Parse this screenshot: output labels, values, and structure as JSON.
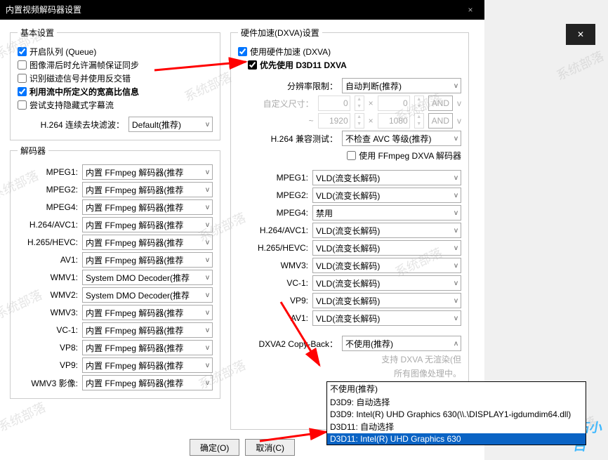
{
  "title": "内置视频解码器设置",
  "close_glyph": "×",
  "side_close_glyph": "✕",
  "basic": {
    "legend": "基本设置",
    "chk_queue": "开启队列 (Queue)",
    "chk_sync": "图像滞后时允许漏帧保证同步",
    "chk_recognize": "识别磁迹信号并使用反交错",
    "chk_aspect": "利用流中所定义的宽高比信息",
    "chk_hidden": "尝试支持隐藏式字幕流",
    "h264_label": "H.264 连续去块滤波：",
    "h264_value": "Default(推荐)"
  },
  "decoders": {
    "legend": "解码器",
    "rows": [
      {
        "label": "MPEG1:",
        "value": "内置 FFmpeg 解码器(推荐"
      },
      {
        "label": "MPEG2:",
        "value": "内置 FFmpeg 解码器(推荐"
      },
      {
        "label": "MPEG4:",
        "value": "内置 FFmpeg 解码器(推荐"
      },
      {
        "label": "H.264/AVC1:",
        "value": "内置 FFmpeg 解码器(推荐"
      },
      {
        "label": "H.265/HEVC:",
        "value": "内置 FFmpeg 解码器(推荐"
      },
      {
        "label": "AV1:",
        "value": "内置 FFmpeg 解码器(推荐"
      },
      {
        "label": "WMV1:",
        "value": "System DMO Decoder(推荐"
      },
      {
        "label": "WMV2:",
        "value": "System DMO Decoder(推荐"
      },
      {
        "label": "WMV3:",
        "value": "内置 FFmpeg 解码器(推荐"
      },
      {
        "label": "VC-1:",
        "value": "内置 FFmpeg 解码器(推荐"
      },
      {
        "label": "VP8:",
        "value": "内置 FFmpeg 解码器(推荐"
      },
      {
        "label": "VP9:",
        "value": "内置 FFmpeg 解码器(推荐"
      },
      {
        "label": "WMV3 影像:",
        "value": "内置 FFmpeg 解码器(推荐"
      }
    ]
  },
  "dxva": {
    "legend": "硬件加速(DXVA)设置",
    "chk_enable": "使用硬件加速 (DXVA)",
    "chk_d3d11": "优先使用 D3D11 DXVA",
    "res_limit_label": "分辨率限制：",
    "res_limit_value": "自动判断(推荐)",
    "custom_size_label": "自定义尺寸：",
    "num0a": "0",
    "num0b": "0",
    "andA": "AND",
    "x": "×",
    "tilde": "~",
    "num1920": "1920",
    "num1080": "1080",
    "andB": "AND",
    "h264_compat_label": "H.264 兼容测试：",
    "h264_compat_value": "不检查 AVC 等级(推荐)",
    "chk_ffmpeg_dxva": "使用 FFmpeg DXVA 解码器",
    "rows": [
      {
        "label": "MPEG1:",
        "value": "VLD(流变长解码)"
      },
      {
        "label": "MPEG2:",
        "value": "VLD(流变长解码)"
      },
      {
        "label": "MPEG4:",
        "value": "禁用"
      },
      {
        "label": "H.264/AVC1:",
        "value": "VLD(流变长解码)"
      },
      {
        "label": "H.265/HEVC:",
        "value": "VLD(流变长解码)"
      },
      {
        "label": "WMV3:",
        "value": "VLD(流变长解码)"
      },
      {
        "label": "VC-1:",
        "value": "VLD(流变长解码)"
      },
      {
        "label": "VP9:",
        "value": "VLD(流变长解码)"
      },
      {
        "label": "AV1:",
        "value": "VLD(流变长解码)"
      }
    ],
    "copyback_label": "DXVA2 Copy-Back：",
    "copyback_value": "不使用(推荐)",
    "note": "支持 DXVA 无渲染(但",
    "note2": "所有图像处理中。"
  },
  "dropdown": {
    "items": [
      "不使用(推荐)",
      "D3D9: 自动选择",
      "D3D9: Intel(R) UHD Graphics 630(\\\\.\\DISPLAY1-igdumdim64.dll)",
      "D3D11: 自动选择",
      "D3D11: Intel(R) UHD Graphics 630"
    ],
    "selected_index": 4
  },
  "buttons": {
    "ok": "确定(O)",
    "cancel": "取消(C)"
  },
  "resize_brand": "石小白"
}
